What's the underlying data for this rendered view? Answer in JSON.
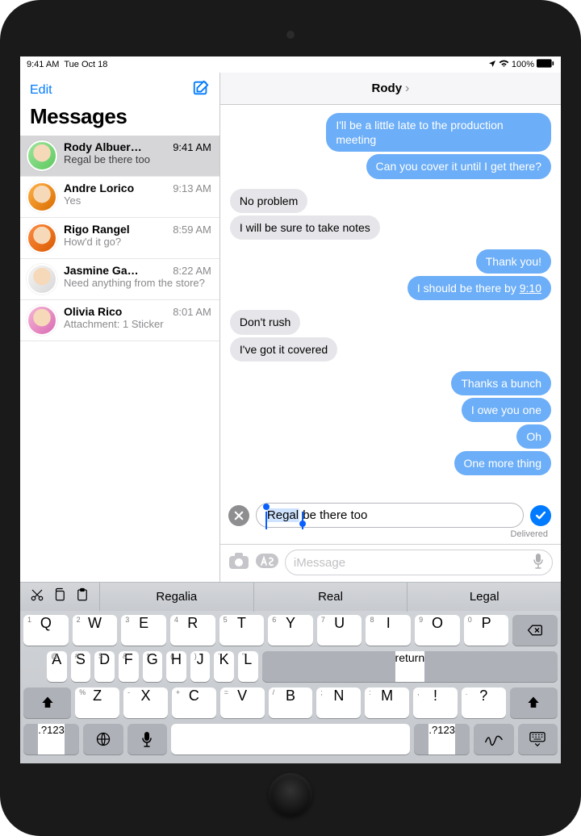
{
  "status": {
    "time": "9:41 AM",
    "date": "Tue Oct 18",
    "battery_pct": "100%"
  },
  "sidebar": {
    "edit_label": "Edit",
    "title": "Messages",
    "conversations": [
      {
        "name": "Rody Albuer…",
        "time": "9:41 AM",
        "preview": "Regal be there too",
        "selected": true
      },
      {
        "name": "Andre Lorico",
        "time": "9:13 AM",
        "preview": "Yes"
      },
      {
        "name": "Rigo Rangel",
        "time": "8:59 AM",
        "preview": "How'd it go?"
      },
      {
        "name": "Jasmine Ga…",
        "time": "8:22 AM",
        "preview": "Need anything from the store?"
      },
      {
        "name": "Olivia Rico",
        "time": "8:01 AM",
        "preview": "Attachment: 1 Sticker"
      }
    ]
  },
  "conversation": {
    "title": "Rody",
    "messages": [
      {
        "side": "out",
        "text": "I'll be a little late to the production meeting"
      },
      {
        "side": "out",
        "text": "Can you cover it until I get there?"
      },
      {
        "side": "in",
        "text": "No problem"
      },
      {
        "side": "in",
        "text": "I will be sure to take notes"
      },
      {
        "side": "out",
        "text": "Thank you!"
      },
      {
        "side": "out",
        "text": "I should be there by ",
        "time_suffix": "9:10"
      },
      {
        "side": "in",
        "text": "Don't rush"
      },
      {
        "side": "in",
        "text": "I've got it covered"
      },
      {
        "side": "out",
        "text": "Thanks a bunch"
      },
      {
        "side": "out",
        "text": "I owe you one"
      },
      {
        "side": "out",
        "text": "Oh"
      },
      {
        "side": "out",
        "text": "One more thing"
      }
    ],
    "editing": {
      "selected_text": "Regal",
      "rest_text": " be there too"
    },
    "delivered_label": "Delivered",
    "compose_placeholder": "iMessage"
  },
  "predictions": {
    "suggestions": [
      "Regalia",
      "Real",
      "Legal"
    ]
  },
  "keyboard": {
    "row1": [
      {
        "l": "Q",
        "t": "1"
      },
      {
        "l": "W",
        "t": "2"
      },
      {
        "l": "E",
        "t": "3"
      },
      {
        "l": "R",
        "t": "4"
      },
      {
        "l": "T",
        "t": "5"
      },
      {
        "l": "Y",
        "t": "6"
      },
      {
        "l": "U",
        "t": "7"
      },
      {
        "l": "I",
        "t": "8"
      },
      {
        "l": "O",
        "t": "9"
      },
      {
        "l": "P",
        "t": "0"
      }
    ],
    "row2": [
      {
        "l": "A",
        "t": "@"
      },
      {
        "l": "S",
        "t": "#"
      },
      {
        "l": "D",
        "t": "$"
      },
      {
        "l": "F",
        "t": "&"
      },
      {
        "l": "G",
        "t": "*"
      },
      {
        "l": "H",
        "t": "("
      },
      {
        "l": "J",
        "t": ")"
      },
      {
        "l": "K",
        "t": "'"
      },
      {
        "l": "L",
        "t": "\""
      }
    ],
    "row3": [
      {
        "l": "Z",
        "t": "%"
      },
      {
        "l": "X",
        "t": "-"
      },
      {
        "l": "C",
        "t": "+"
      },
      {
        "l": "V",
        "t": "="
      },
      {
        "l": "B",
        "t": "/"
      },
      {
        "l": "N",
        "t": ";"
      },
      {
        "l": "M",
        "t": ":"
      },
      {
        "l": "!",
        "t": ","
      },
      {
        "l": "?",
        "t": "."
      }
    ],
    "numkey_label": ".?123",
    "return_label": "return"
  }
}
